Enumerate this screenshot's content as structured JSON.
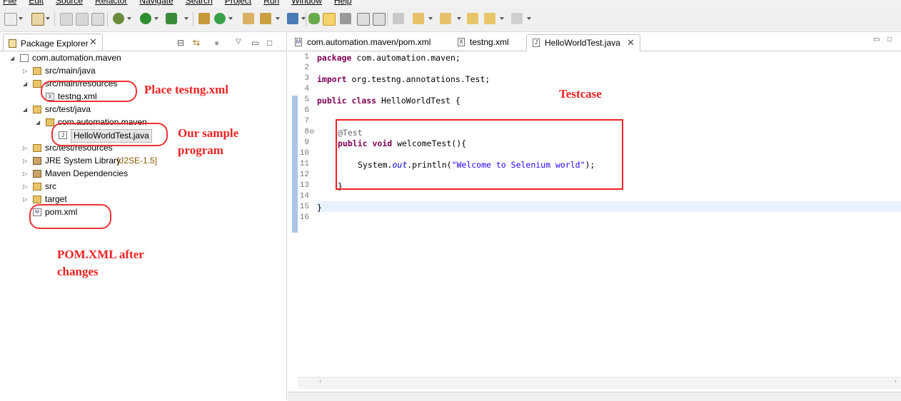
{
  "menu": [
    "File",
    "Edit",
    "Source",
    "Refactor",
    "Navigate",
    "Search",
    "Project",
    "Run",
    "Window",
    "Help"
  ],
  "explorer": {
    "tab_label": "Package Explorer",
    "tree": [
      {
        "label": "com.automation.maven",
        "level": 0,
        "expanded": true,
        "kind": "project"
      },
      {
        "label": "src/main/java",
        "level": 1,
        "expanded": false,
        "kind": "pkgfolder"
      },
      {
        "label": "src/main/resources",
        "level": 1,
        "expanded": true,
        "kind": "pkgfolder"
      },
      {
        "label": "testng.xml",
        "level": 2,
        "expanded": false,
        "kind": "xml"
      },
      {
        "label": "src/test/java",
        "level": 1,
        "expanded": true,
        "kind": "pkgfolder"
      },
      {
        "label": "com.automation.maven",
        "level": 2,
        "expanded": true,
        "kind": "package"
      },
      {
        "label": "HelloWorldTest.java",
        "level": 3,
        "expanded": false,
        "kind": "java",
        "selected": true
      },
      {
        "label": "src/test/resources",
        "level": 1,
        "expanded": false,
        "kind": "pkgfolder"
      },
      {
        "label": "JRE System Library",
        "decor": "[J2SE-1.5]",
        "level": 1,
        "expanded": false,
        "kind": "lib"
      },
      {
        "label": "Maven Dependencies",
        "level": 1,
        "expanded": false,
        "kind": "lib"
      },
      {
        "label": "src",
        "level": 1,
        "expanded": false,
        "kind": "folder"
      },
      {
        "label": "target",
        "level": 1,
        "expanded": false,
        "kind": "folder"
      },
      {
        "label": "pom.xml",
        "level": 1,
        "expanded": false,
        "kind": "pom"
      }
    ]
  },
  "annotations": {
    "place_testng": "Place testng.xml",
    "sample_line1": "Our sample",
    "sample_line2": "program",
    "pom_line1": "POM.XML after",
    "pom_line2": "changes",
    "testcase": "Testcase"
  },
  "editor": {
    "tabs": [
      {
        "label": "com.automation.maven/pom.xml",
        "icon": "M",
        "active": false
      },
      {
        "label": "testng.xml",
        "icon": "X",
        "active": false
      },
      {
        "label": "HelloWorldTest.java",
        "icon": "J",
        "active": true
      }
    ],
    "line_numbers": [
      "1",
      "2",
      "3",
      "4",
      "5",
      "6",
      "7",
      "8",
      "9",
      "10",
      "11",
      "12",
      "13",
      "14",
      "15",
      "16"
    ],
    "code": {
      "l1_kw": "package",
      "l1_rest": " com.automation.maven;",
      "l3_kw": "import",
      "l3_rest": " org.testng.annotations.Test;",
      "l5_kw1": "public",
      "l5_kw2": "class",
      "l5_rest": " HelloWorldTest {",
      "l8_ann": "@Test",
      "l9_kw1": "public",
      "l9_kw2": "void",
      "l9_rest": " welcomeTest(){",
      "l11_pre": "System.",
      "l11_field": "out",
      "l11_mid": ".println(",
      "l11_str": "\"Welcome to Selenium world\"",
      "l11_end": ");",
      "l13": "}",
      "l15": "}"
    }
  },
  "colors": {
    "annotation": "#e22222",
    "keyword": "#7f0055",
    "string": "#2a00ff",
    "ruler": "#a9c6e6"
  }
}
